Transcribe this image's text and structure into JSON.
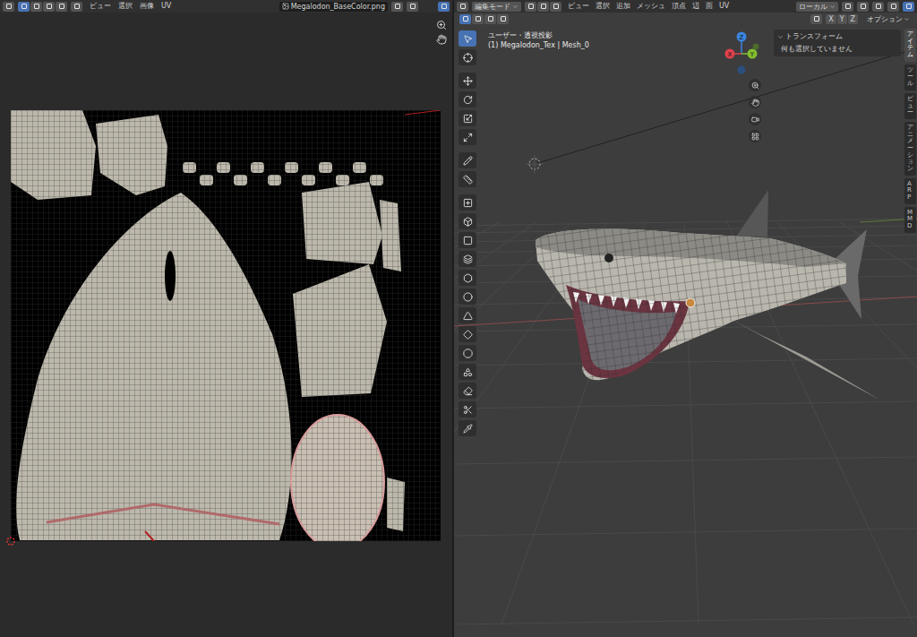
{
  "uv_editor": {
    "menus": [
      "ビュー",
      "選択",
      "画像",
      "UV"
    ],
    "image_name": "Megalodon_BaseColor.png",
    "select_modes": [
      {
        "selected": true
      },
      {
        "selected": false
      },
      {
        "selected": false
      },
      {
        "selected": false
      }
    ]
  },
  "viewport": {
    "mode": "編集モード",
    "menus": [
      "ビュー",
      "選択",
      "追加",
      "メッシュ",
      "頂点",
      "辺",
      "面",
      "UV"
    ],
    "orientation": "ローカル",
    "mirror_axes": [
      "X",
      "Y",
      "Z"
    ],
    "options": "オプション",
    "view_name": "ユーザー・透視投影",
    "object_info": "(1) Megalodon_Tex | Mesh_0",
    "select_modes": [
      {
        "selected": true
      },
      {
        "selected": false
      },
      {
        "selected": false
      },
      {
        "selected": false
      }
    ],
    "tools": [
      {
        "selected": true
      },
      {
        "selected": false
      },
      {
        "selected": false
      },
      {
        "selected": false
      },
      {
        "selected": false
      },
      {
        "selected": false
      },
      {
        "selected": false
      },
      {
        "selected": false
      },
      {
        "selected": false
      },
      {
        "selected": false
      },
      {
        "selected": false
      },
      {
        "selected": false
      },
      {
        "selected": false
      },
      {
        "selected": false
      },
      {
        "selected": false
      },
      {
        "selected": false
      },
      {
        "selected": false
      },
      {
        "selected": false
      },
      {
        "selected": false
      },
      {
        "selected": false
      },
      {
        "selected": false
      }
    ],
    "gizmo": [
      {
        "label": "X",
        "color": "#e0424d"
      },
      {
        "label": "Y",
        "color": "#82bd2f"
      },
      {
        "label": "Z",
        "color": "#3a85e0"
      }
    ]
  },
  "sidebar": {
    "panel_title": "トランスフォーム",
    "message": "何も選択していません",
    "tabs": [
      {
        "label": "アイテム",
        "selected": true
      },
      {
        "label": "ツール",
        "selected": false
      },
      {
        "label": "ビュー",
        "selected": false
      },
      {
        "label": "アニメーション",
        "selected": false
      },
      {
        "label": "ARP",
        "selected": false
      },
      {
        "label": "MMD",
        "selected": false
      }
    ]
  }
}
